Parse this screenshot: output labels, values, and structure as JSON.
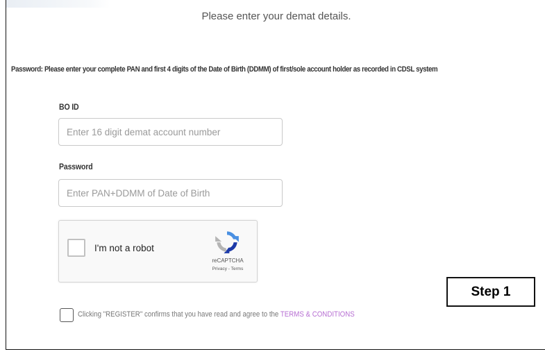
{
  "heading": "Please enter your demat details.",
  "instruction": "Password: Please enter your complete PAN and first 4 digits of the Date of Birth (DDMM) of first/sole account holder as recorded in CDSL system",
  "bo_id": {
    "label": "BO ID",
    "placeholder": "Enter 16 digit demat account number",
    "value": ""
  },
  "password": {
    "label": "Password",
    "placeholder": "Enter PAN+DDMM of Date of Birth",
    "value": ""
  },
  "captcha": {
    "text": "I'm not a robot",
    "brand": "reCAPTCHA",
    "privacy": "Privacy",
    "separator": " - ",
    "terms": "Terms",
    "checked": false,
    "icon": "recaptcha-logo-icon"
  },
  "step_label": "Step 1",
  "terms": {
    "text": "Clicking \"REGISTER\" confirms that you have read and agree to the ",
    "link": "TERMS & CONDITIONS",
    "checked": false
  },
  "colors": {
    "link": "#b76fd3",
    "border": "#c9c9c9",
    "recaptcha_blue": "#4a90e2",
    "recaptcha_dark": "#1c3aa9",
    "recaptcha_gray": "#b5b5b5"
  }
}
